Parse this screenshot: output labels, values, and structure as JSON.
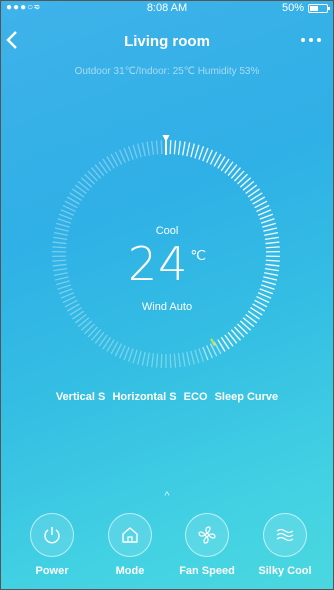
{
  "status_bar": {
    "signal": "●●●○○",
    "time": "8:08 AM",
    "battery_text": "50%",
    "battery_level": 0.5
  },
  "header": {
    "title": "Living room",
    "back_icon": "chevron-left-icon",
    "more_icon": "more-dots-icon"
  },
  "conditions": "Outdoor 31℃/Indoor: 25℃ Humidity 53%",
  "dial": {
    "mode": "Cool",
    "temperature": "24",
    "unit": "℃",
    "wind": "Wind Auto"
  },
  "features": [
    "Vertical S",
    "Horizontal S",
    "ECO",
    "Sleep Curve"
  ],
  "expand_icon": "^",
  "controls": [
    {
      "label": "Power",
      "icon": "power-icon"
    },
    {
      "label": "Mode",
      "icon": "home-icon"
    },
    {
      "label": "Fan Speed",
      "icon": "fan-icon"
    },
    {
      "label": "Silky Cool",
      "icon": "waves-icon"
    }
  ],
  "colors": {
    "background_start": "#3fb2ea",
    "background_end": "#4ad7df",
    "accent_marker": "#c8e05a"
  }
}
